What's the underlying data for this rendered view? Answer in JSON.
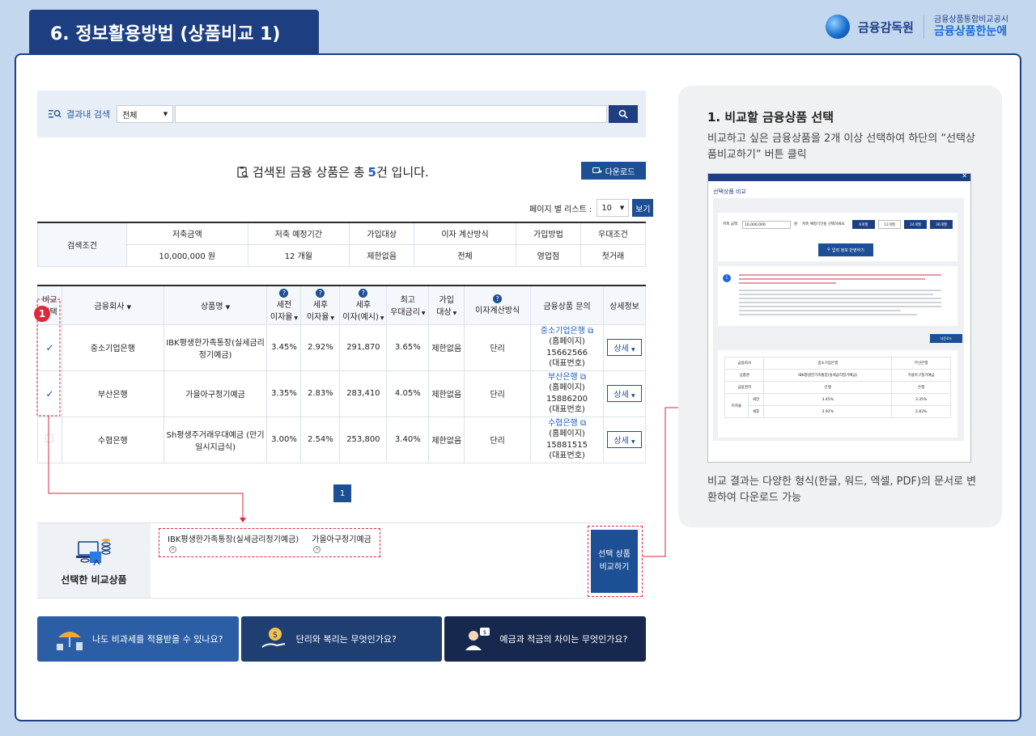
{
  "header": {
    "title": "6. 정보활용방법 (상품비교 1)",
    "brand_main": "금융감독원",
    "brand_sub_small": "금융상품통합비교공시",
    "brand_sub_big": "금융상품한눈에"
  },
  "search": {
    "label": "결과내 검색",
    "select_value": "전체",
    "input_value": "",
    "icon": "search-icon"
  },
  "results": {
    "prefix": "검색된 금융 상품은 총",
    "count": "5",
    "suffix": "건 입니다.",
    "download_label": "다운로드",
    "page_list_label": "페이지 별 리스트 :",
    "page_size": "10",
    "view_label": "보기"
  },
  "conditions": {
    "row_label": "검색조건",
    "headers": [
      "저축금액",
      "저축 예정기간",
      "가입대상",
      "이자 계산방식",
      "가입방법",
      "우대조건"
    ],
    "values": [
      "10,000,000 원",
      "12 개월",
      "제한없음",
      "전체",
      "영업점",
      "첫거래"
    ]
  },
  "products": {
    "headers": {
      "select": "비교\n선택",
      "company": "금융회사",
      "name": "상품명",
      "pre_tax": "세전\n이자율",
      "post_tax": "세후\n이자율",
      "post_interest": "세후\n이자(예시)",
      "max_pref": "최고\n우대금리",
      "target": "가입\n대상",
      "calc": "이자계산방식",
      "inquiry": "금융상품 문의",
      "detail": "상세정보"
    },
    "rows": [
      {
        "checked": true,
        "company": "중소기업은행",
        "name": "IBK평생한가족통장(실세금리정기예금)",
        "pre_tax": "3.45%",
        "post_tax": "2.92%",
        "interest": "291,870",
        "max_pref": "3.65%",
        "target": "제한없음",
        "calc": "단리",
        "inq_link": "중소기업은행",
        "inq_home": "(홈페이지)",
        "inq_phone": "15662566",
        "inq_rep": "(대표번호)",
        "detail_label": "상세"
      },
      {
        "checked": true,
        "company": "부산은행",
        "name": "가을아구정기예금",
        "pre_tax": "3.35%",
        "post_tax": "2.83%",
        "interest": "283,410",
        "max_pref": "4.05%",
        "target": "제한없음",
        "calc": "단리",
        "inq_link": "부산은행",
        "inq_home": "(홈페이지)",
        "inq_phone": "15886200",
        "inq_rep": "(대표번호)",
        "detail_label": "상세"
      },
      {
        "checked": false,
        "company": "수협은행",
        "name": "Sh평생주거래우대예금 (만기일시지급식)",
        "pre_tax": "3.00%",
        "post_tax": "2.54%",
        "interest": "253,800",
        "max_pref": "3.40%",
        "target": "제한없음",
        "calc": "단리",
        "inq_link": "수협은행",
        "inq_home": "(홈페이지)",
        "inq_phone": "15881515",
        "inq_rep": "(대표번호)",
        "detail_label": "상세"
      }
    ]
  },
  "badge": "1",
  "pagination": {
    "current": "1"
  },
  "selected": {
    "label": "선택한 비교상품",
    "items": [
      "IBK평생한가족통장(실세금리정기예금)",
      "가을아구정기예금"
    ],
    "compare_line1": "선택 상품",
    "compare_line2": "비교하기"
  },
  "info_cards": [
    {
      "label": "나도 비과세를 적용받을 수 있나요?",
      "icon": "umbrella-coins-icon"
    },
    {
      "label": "단리와 복리는 무엇인가요?",
      "icon": "coin-hand-icon"
    },
    {
      "label": "예금과 적금의 차이는 무엇인가요?",
      "icon": "person-money-icon"
    }
  ],
  "side": {
    "heading": "1. 비교할 금융상품 선택",
    "desc": "비교하고 싶은 금융상품을 2개 이상 선택하여 하단의 “선택상품비교하기” 버튼 클릭",
    "footer": "비교 결과는 다양한 형식(한글, 워드, 엑셀, PDF)의 문서로 변환하여 다운로드 가능",
    "popup": {
      "title": "선택상품 비교",
      "amount_label": "저축 금액",
      "amount_value": "10,000,000",
      "unit": "원",
      "period_label": "저축 예정기간을 선택하세요",
      "tabs": [
        "6개월",
        "12개월",
        "24개월",
        "36개월"
      ],
      "apply": "입력 정보 반영하기",
      "download": "다운로드",
      "close": "닫기",
      "cmp_rows": [
        [
          "금융회사",
          "",
          "중소기업은행",
          "부산은행"
        ],
        [
          "상품명",
          "",
          "IBK평생한가족통장(실세금리정기예금)",
          "가을아구정기예금"
        ],
        [
          "금융권역",
          "",
          "은행",
          "은행"
        ],
        [
          "이자율",
          "세전",
          "3.45%",
          "3.35%"
        ],
        [
          "",
          "세후",
          "2.92%",
          "2.83%"
        ]
      ]
    }
  }
}
